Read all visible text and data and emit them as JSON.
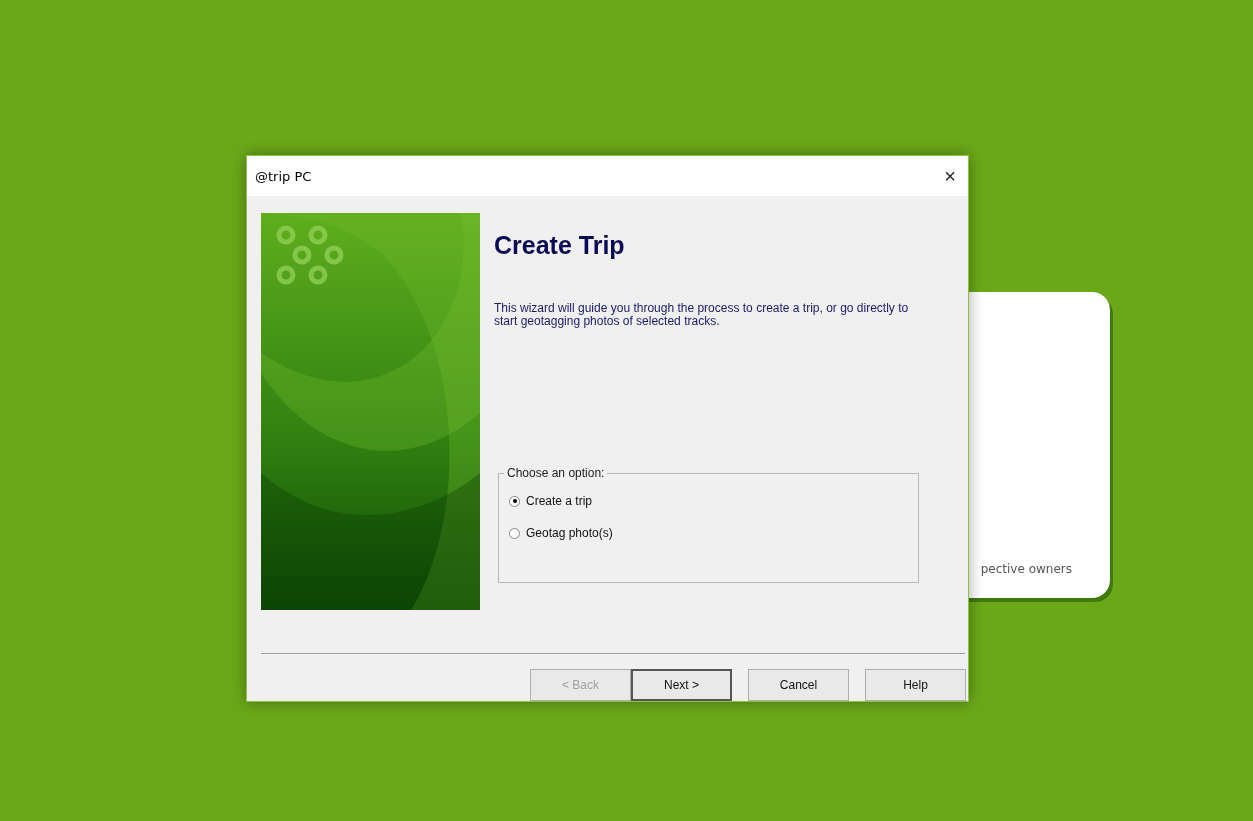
{
  "background_window": {
    "text": "pective owners"
  },
  "window": {
    "title": "@trip PC",
    "close": "×"
  },
  "page": {
    "title": "Create Trip",
    "description": "This wizard will guide you through the process to create a trip, or go directly to start geotagging photos of selected tracks."
  },
  "option_group": {
    "label": "Choose an option:",
    "options": [
      {
        "label": "Create a trip",
        "selected": true
      },
      {
        "label": "Geotag photo(s)",
        "selected": false
      }
    ]
  },
  "buttons": [
    {
      "label": "< Back",
      "disabled": true,
      "default": false
    },
    {
      "label": "Next >",
      "disabled": false,
      "default": true
    },
    {
      "label": "Cancel",
      "disabled": false,
      "default": false
    },
    {
      "label": "Help",
      "disabled": false,
      "default": false
    }
  ]
}
